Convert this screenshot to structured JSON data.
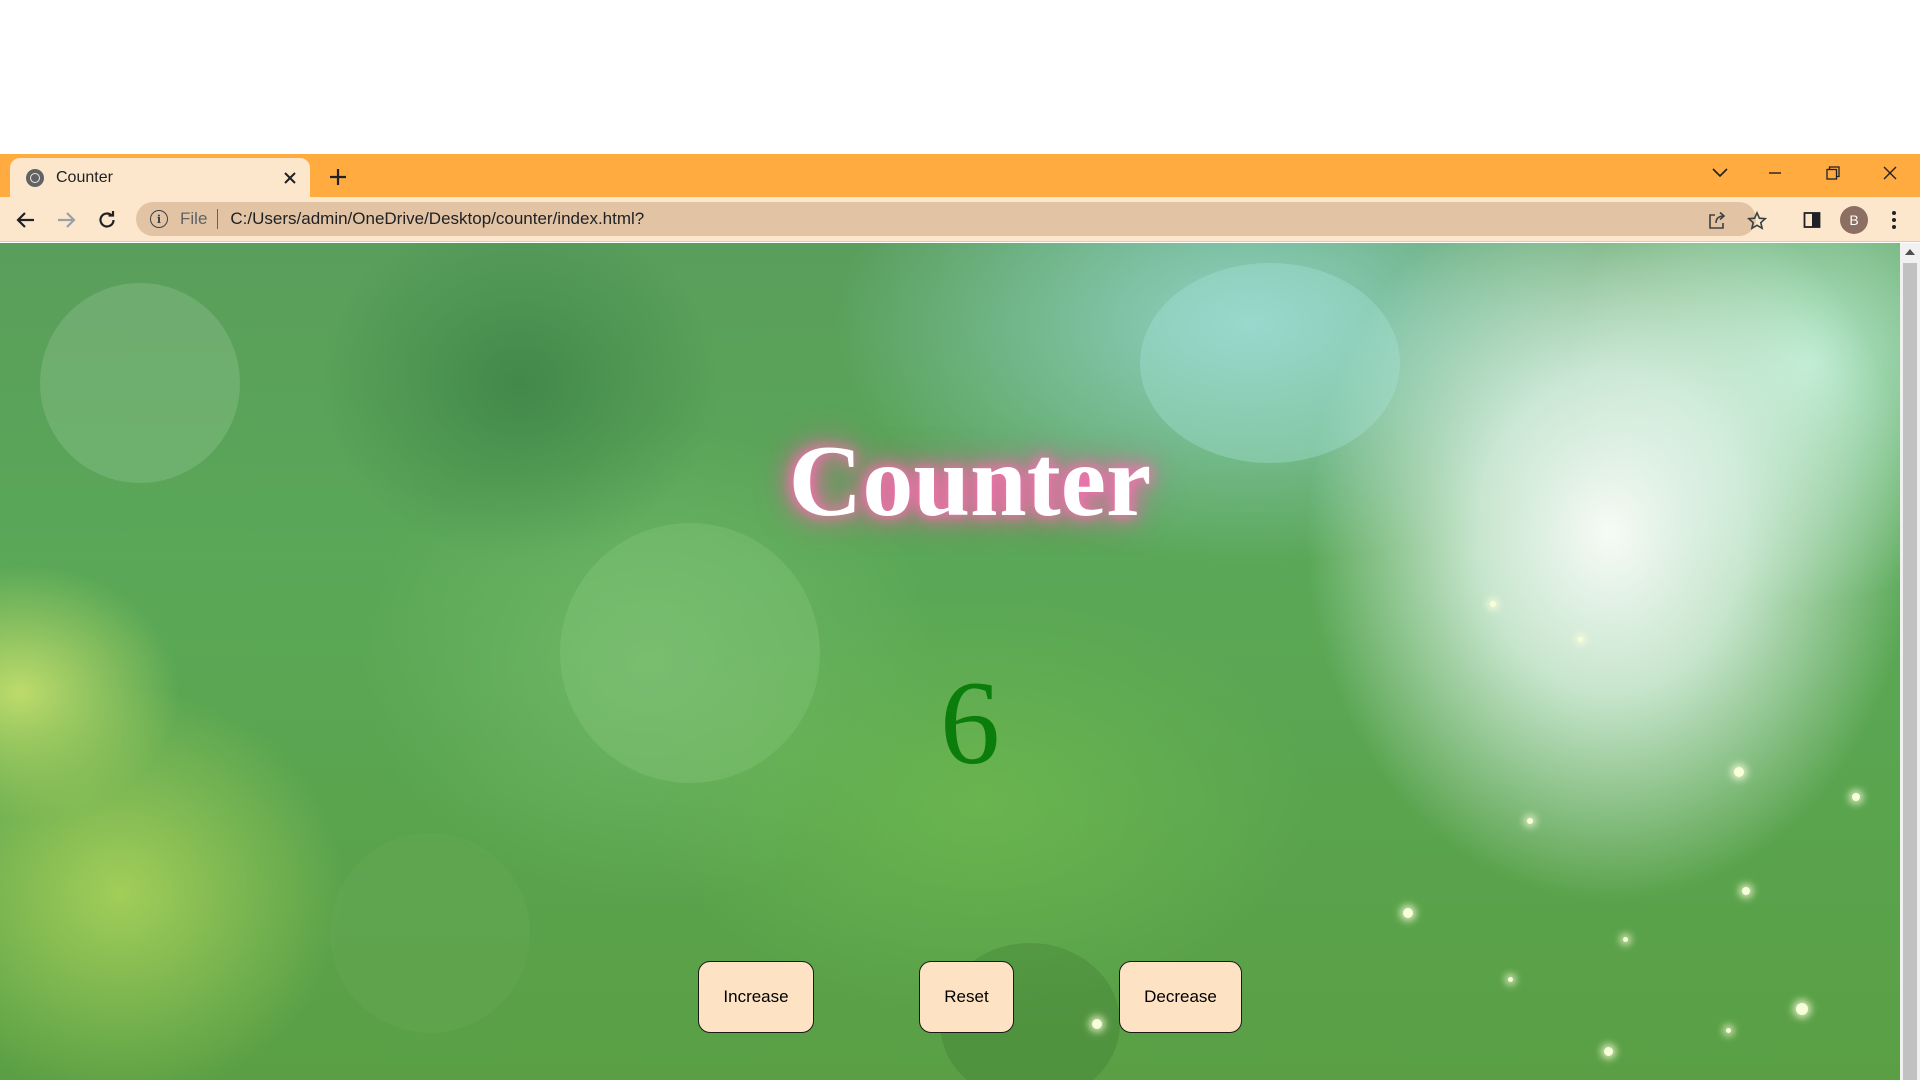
{
  "browser": {
    "tab_title": "Counter",
    "url_scheme": "File",
    "url": "C:/Users/admin/OneDrive/Desktop/counter/index.html?",
    "profile_initial": "B"
  },
  "page": {
    "heading": "Counter",
    "count": "6",
    "buttons": {
      "increase": "Increase",
      "reset": "Reset",
      "decrease": "Decrease"
    }
  },
  "colors": {
    "tabstrip": "#ffab40",
    "toolbar": "#fde7cc",
    "heading_glow": "#ff6fb4",
    "count_text": "#0b7d0b",
    "button_bg": "#fde2c4"
  },
  "icons": [
    "globe-icon",
    "close-icon",
    "plus-icon",
    "chevron-down-icon",
    "minimize-icon",
    "restore-icon",
    "back-arrow-icon",
    "forward-arrow-icon",
    "reload-icon",
    "info-icon",
    "share-icon",
    "star-icon",
    "side-panel-icon",
    "more-vert-icon"
  ]
}
